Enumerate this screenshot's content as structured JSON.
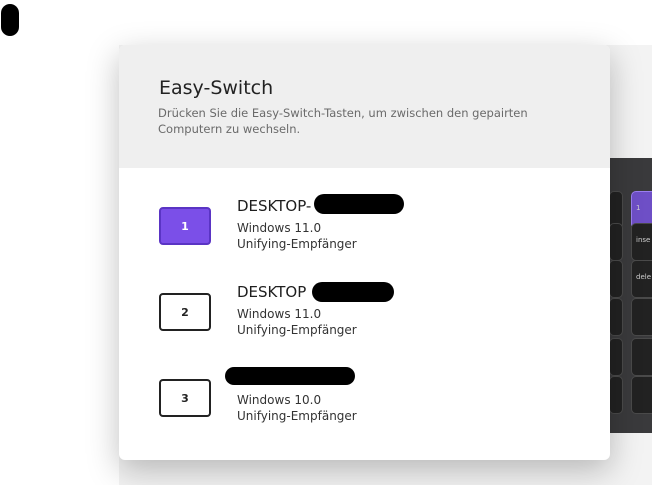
{
  "panel": {
    "title": "Easy-Switch",
    "subtitle": "Drücken Sie die Easy-Switch-Tasten, um zwischen den gepairten Computern zu wechseln."
  },
  "channels": [
    {
      "number": "1",
      "name": "DESKTOP-",
      "os": "Windows 11.0",
      "receiver": "Unifying-Empfänger",
      "active": true
    },
    {
      "number": "2",
      "name": "DESKTOP",
      "os": "Windows 11.0",
      "receiver": "Unifying-Empfänger",
      "active": false
    },
    {
      "number": "3",
      "name": "",
      "os": "Windows 10.0",
      "receiver": "Unifying-Empfänger",
      "active": false
    }
  ],
  "keyboard": {
    "keys": [
      "1",
      "inse",
      "dele"
    ]
  },
  "colors": {
    "accent": "#7b4fe8",
    "header_bg": "#efefef"
  }
}
